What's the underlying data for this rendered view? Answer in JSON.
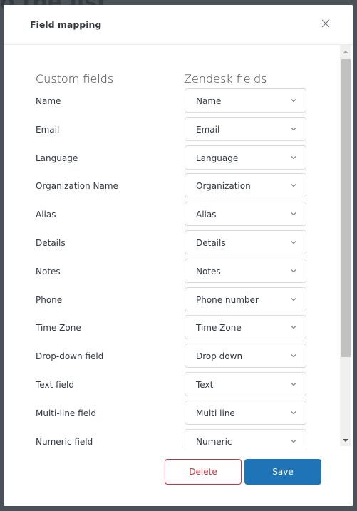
{
  "background": {
    "partial_text": "o the list"
  },
  "modal": {
    "title": "Field mapping",
    "close_label": "Close"
  },
  "columns": {
    "left": "Custom fields",
    "right": "Zendesk fields"
  },
  "mappings": [
    {
      "label": "Name",
      "value": "Name"
    },
    {
      "label": "Email",
      "value": "Email"
    },
    {
      "label": "Language",
      "value": "Language"
    },
    {
      "label": "Organization Name",
      "value": "Organization"
    },
    {
      "label": "Alias",
      "value": "Alias"
    },
    {
      "label": "Details",
      "value": "Details"
    },
    {
      "label": "Notes",
      "value": "Notes"
    },
    {
      "label": "Phone",
      "value": "Phone number"
    },
    {
      "label": "Time Zone",
      "value": "Time Zone"
    },
    {
      "label": "Drop-down field",
      "value": "Drop down"
    },
    {
      "label": "Text field",
      "value": "Text"
    },
    {
      "label": "Multi-line field",
      "value": "Multi line"
    },
    {
      "label": "Numeric field",
      "value": "Numeric"
    }
  ],
  "footer": {
    "delete_label": "Delete",
    "save_label": "Save"
  },
  "colors": {
    "primary": "#1f73b7",
    "danger": "#cc3340",
    "text": "#2f3941",
    "border": "#d8dcde"
  }
}
